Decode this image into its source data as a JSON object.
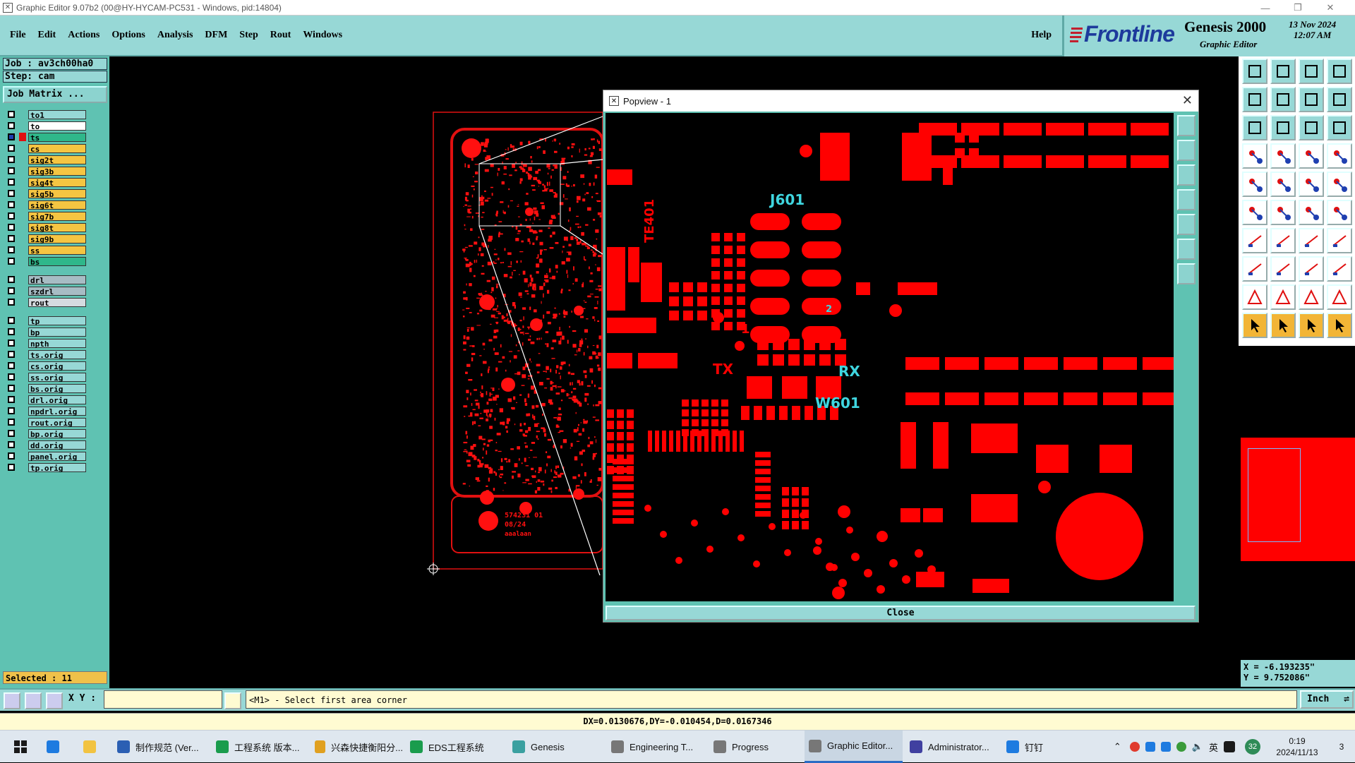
{
  "window": {
    "title": "Graphic Editor 9.07b2 (00@HY-HYCAM-PC531 - Windows, pid:14804)"
  },
  "menu": {
    "items": [
      "File",
      "Edit",
      "Actions",
      "Options",
      "Analysis",
      "DFM",
      "Step",
      "Rout",
      "Windows"
    ],
    "help": "Help"
  },
  "brand": {
    "logo": "Frontline",
    "product": "Genesis 2000",
    "subtitle": "Graphic Editor",
    "date": "13 Nov 2024",
    "time": "12:07 AM"
  },
  "job": {
    "job_label": "Job  : av3ch00ha0",
    "step_label": "Step: cam",
    "matrix_button": "Job Matrix ..."
  },
  "layers": [
    {
      "name": "to1",
      "color": "#97d8d6"
    },
    {
      "name": "to",
      "color": "#ffffff"
    },
    {
      "name": "ts",
      "color": "#2fb78a",
      "active": true
    },
    {
      "name": "cs",
      "color": "#f5c542"
    },
    {
      "name": "sig2t",
      "color": "#f5c542"
    },
    {
      "name": "sig3b",
      "color": "#f5c542"
    },
    {
      "name": "sig4t",
      "color": "#f5c542"
    },
    {
      "name": "sig5b",
      "color": "#f5c542"
    },
    {
      "name": "sig6t",
      "color": "#f5c542"
    },
    {
      "name": "sig7b",
      "color": "#f5c542"
    },
    {
      "name": "sig8t",
      "color": "#f5c542"
    },
    {
      "name": "sig9b",
      "color": "#f5c542"
    },
    {
      "name": "ss",
      "color": "#f5c542"
    },
    {
      "name": "bs",
      "color": "#2fb78a"
    },
    {
      "name": "drl",
      "color": "#a7bcc4"
    },
    {
      "name": "szdrl",
      "color": "#a7bcc4"
    },
    {
      "name": "rout",
      "color": "#d5dbe0"
    },
    {
      "name": "tp",
      "color": "#97d8d6"
    },
    {
      "name": "bp",
      "color": "#97d8d6"
    },
    {
      "name": "npth",
      "color": "#97d8d6"
    },
    {
      "name": "ts.orig",
      "color": "#97d8d6"
    },
    {
      "name": "cs.orig",
      "color": "#97d8d6"
    },
    {
      "name": "ss.orig",
      "color": "#97d8d6"
    },
    {
      "name": "bs.orig",
      "color": "#97d8d6"
    },
    {
      "name": "drl.orig",
      "color": "#97d8d6"
    },
    {
      "name": "npdrl.orig",
      "color": "#97d8d6"
    },
    {
      "name": "rout.orig",
      "color": "#97d8d6"
    },
    {
      "name": "bp.orig",
      "color": "#97d8d6"
    },
    {
      "name": "dd.orig",
      "color": "#97d8d6"
    },
    {
      "name": "panel.orig",
      "color": "#97d8d6"
    },
    {
      "name": "tp.orig",
      "color": "#97d8d6"
    }
  ],
  "selected": "Selected : 11",
  "popview": {
    "title": "Popview - 1",
    "close_label": "Close",
    "labels": [
      "J601",
      "TX",
      "RX",
      "W601",
      "TE401",
      "2",
      "1"
    ]
  },
  "board": {
    "text1": "574231 01",
    "text2": "08/24",
    "text3": "aaalaan"
  },
  "coords": {
    "x": "X = -6.193235\"",
    "y": "Y =  9.752086\""
  },
  "statusbar": {
    "xy_label": "X Y :",
    "xy_value": "",
    "prompt": "<M1> - Select first area corner",
    "units": "Inch"
  },
  "measure": "DX=0.0130676,DY=-0.010454,D=0.0167346",
  "taskbar": {
    "items": [
      {
        "label": "制作规范 (Ver...",
        "color": "#2b5fb3"
      },
      {
        "label": "工程系统   版本...",
        "color": "#1a9c4d"
      },
      {
        "label": "兴森快捷衡阳分...",
        "color": "#e0a020"
      },
      {
        "label": "EDS工程系统",
        "color": "#1a9c4d"
      },
      {
        "label": "Genesis",
        "color": "#3aa0a0"
      },
      {
        "label": "Engineering T...",
        "color": "#777777"
      },
      {
        "label": "Progress",
        "color": "#777777"
      },
      {
        "label": "Graphic Editor...",
        "color": "#777777",
        "active": true
      },
      {
        "label": "Administrator...",
        "color": "#4040a0"
      },
      {
        "label": "钉钉",
        "color": "#1e7be0"
      }
    ],
    "tray_lang": "英",
    "time": "0:19",
    "date": "2024/11/13",
    "notif": "3",
    "badge": "32"
  }
}
